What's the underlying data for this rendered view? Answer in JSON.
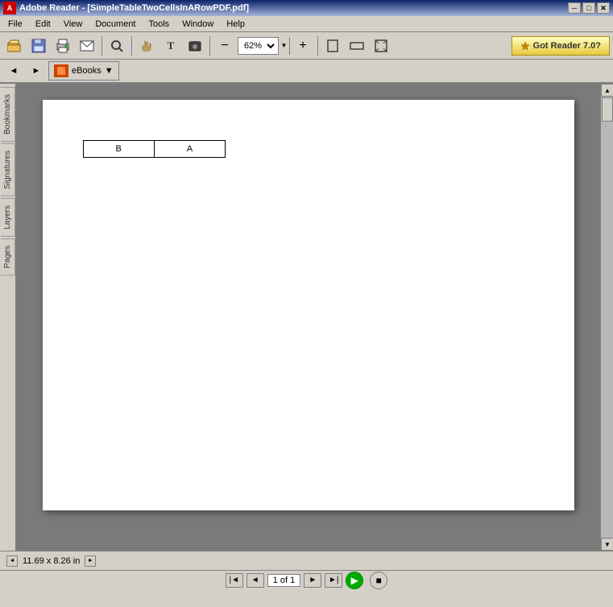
{
  "titleBar": {
    "text": "Adobe Reader - [SimpleTableTwoCellsInARowPDF.pdf]",
    "minBtn": "─",
    "maxBtn": "□",
    "closeBtn": "✕",
    "innerMinBtn": "─",
    "innerCloseBtn": "✕"
  },
  "menuBar": {
    "items": [
      "File",
      "Edit",
      "View",
      "Document",
      "Tools",
      "Window",
      "Help"
    ]
  },
  "toolbar": {
    "zoom": "62%",
    "gotReaderLabel": "Got Reader 7.0?"
  },
  "ebooks": {
    "label": "eBooks"
  },
  "leftTabs": {
    "tabs": [
      "Bookmarks",
      "Signatures",
      "Layers",
      "Pages"
    ]
  },
  "pdfTable": {
    "cell1": "B",
    "cell2": "A"
  },
  "statusBar": {
    "dimensions": "11.69 x 8.26 in"
  },
  "navBar": {
    "pageIndicator": "1 of 1"
  }
}
